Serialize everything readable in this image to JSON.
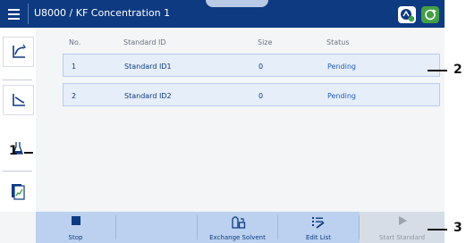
{
  "title_bar": {
    "title": "U8000 / KF Concentration 1"
  },
  "table": {
    "columns": [
      "No.",
      "Standard ID",
      "Size",
      "Status"
    ],
    "rows": [
      {
        "no": "1",
        "standard_id": "Standard ID1",
        "size": "0",
        "status": "Pending"
      },
      {
        "no": "2",
        "standard_id": "Standard ID2",
        "size": "0",
        "status": "Pending"
      }
    ]
  },
  "sidebar": {
    "items": [
      {
        "icon": "curve-chart-icon"
      },
      {
        "icon": "decline-chart-icon"
      },
      {
        "icon": "flask-icon"
      },
      {
        "icon": "report-icon"
      }
    ]
  },
  "bottom_bar": {
    "stop_label": "Stop",
    "exchange_label": "Exchange Solvent",
    "edit_label": "Edit List",
    "start_label": "Start Standard"
  },
  "callouts": {
    "c1": "1",
    "c2": "2",
    "c3": "3"
  },
  "colors": {
    "brand": "#0e3a82",
    "accent_green": "#43a047",
    "row_fill": "#e6eef9",
    "status_text": "#1e5fbf"
  }
}
